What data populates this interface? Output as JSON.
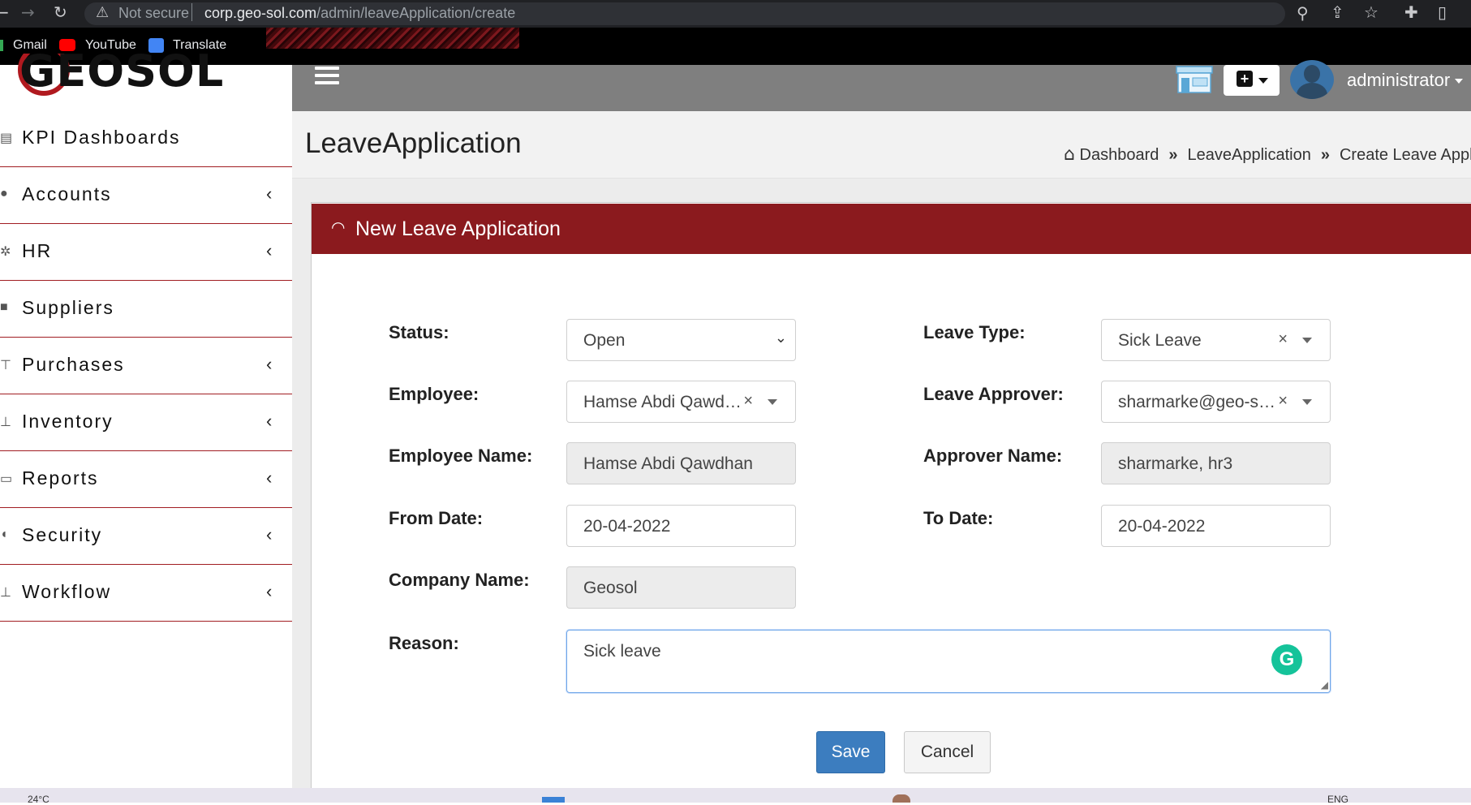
{
  "browser": {
    "security_label": "Not secure",
    "url_host": "corp.geo-sol.com",
    "url_path": "/admin/leaveApplication/create",
    "bookmarks": [
      "Gmail",
      "YouTube",
      "Translate"
    ]
  },
  "app": {
    "logo_text": "GEOSOL",
    "user_name": "administrator",
    "accent_color": "#8b1a1e",
    "header_color": "#7f7f7f"
  },
  "sidebar": {
    "items": [
      {
        "label": "KPI Dashboards",
        "icon": "dashboard-icon",
        "has_submenu": false
      },
      {
        "label": "Accounts",
        "icon": "accounts-icon",
        "has_submenu": true
      },
      {
        "label": "HR",
        "icon": "hr-icon",
        "has_submenu": true
      },
      {
        "label": "Suppliers",
        "icon": "suppliers-icon",
        "has_submenu": false
      },
      {
        "label": "Purchases",
        "icon": "purchases-icon",
        "has_submenu": true
      },
      {
        "label": "Inventory",
        "icon": "inventory-icon",
        "has_submenu": true
      },
      {
        "label": "Reports",
        "icon": "reports-icon",
        "has_submenu": true
      },
      {
        "label": "Security",
        "icon": "lock-icon",
        "has_submenu": true
      },
      {
        "label": "Workflow",
        "icon": "workflow-icon",
        "has_submenu": true
      }
    ]
  },
  "page": {
    "title": "LeaveApplication",
    "breadcrumb": [
      "Dashboard",
      "LeaveApplication",
      "Create Leave Applica"
    ]
  },
  "form": {
    "panel_title": "New Leave Application",
    "status": {
      "label": "Status:",
      "value": "Open"
    },
    "employee": {
      "label": "Employee:",
      "value": "Hamse Abdi Qawd…"
    },
    "employee_name": {
      "label": "Employee Name:",
      "value": "Hamse Abdi Qawdhan"
    },
    "from_date": {
      "label": "From Date:",
      "value": "20-04-2022"
    },
    "company_name": {
      "label": "Company Name:",
      "value": "Geosol"
    },
    "leave_type": {
      "label": "Leave Type:",
      "value": "Sick Leave"
    },
    "leave_approver": {
      "label": "Leave Approver:",
      "value": "sharmarke@geo-s…"
    },
    "approver_name": {
      "label": "Approver Name:",
      "value": "sharmarke, hr3"
    },
    "to_date": {
      "label": "To Date:",
      "value": "20-04-2022"
    },
    "reason": {
      "label": "Reason:",
      "value": "Sick leave"
    },
    "save_label": "Save",
    "cancel_label": "Cancel"
  },
  "taskbar": {
    "temperature": "24°C",
    "language": "ENG"
  }
}
